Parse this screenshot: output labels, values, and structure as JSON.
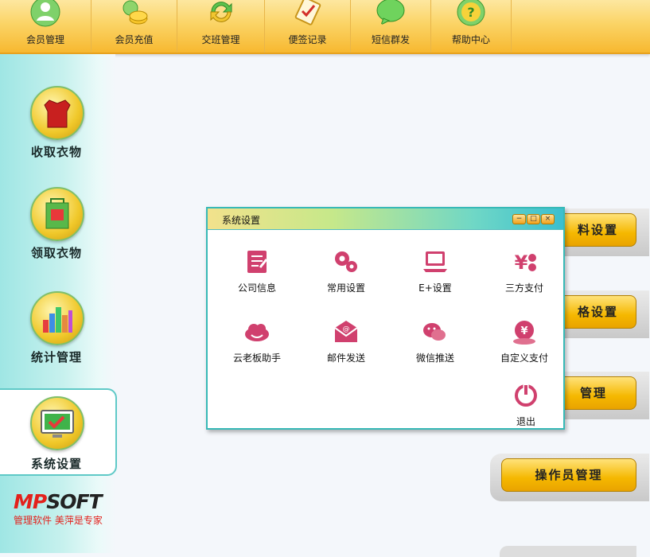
{
  "toolbar": {
    "items": [
      {
        "label": "会员管理",
        "icon": "member-icon"
      },
      {
        "label": "会员充值",
        "icon": "recharge-icon"
      },
      {
        "label": "交班管理",
        "icon": "shift-icon"
      },
      {
        "label": "便签记录",
        "icon": "notes-icon"
      },
      {
        "label": "短信群发",
        "icon": "sms-icon"
      },
      {
        "label": "帮助中心",
        "icon": "help-icon"
      }
    ]
  },
  "sidebar": {
    "items": [
      {
        "label": "收取衣物",
        "icon": "coat-icon"
      },
      {
        "label": "领取衣物",
        "icon": "bag-icon"
      },
      {
        "label": "统计管理",
        "icon": "stats-icon"
      },
      {
        "label": "系统设置",
        "icon": "monitor-icon"
      }
    ],
    "active_index": 3
  },
  "logo": {
    "brand_mp": "MP",
    "brand_soft": "SOFT",
    "slogan": "管理软件  美萍是专家"
  },
  "right_buttons": [
    {
      "label": "料设置"
    },
    {
      "label": "格设置"
    },
    {
      "label": "管理"
    },
    {
      "label": "操作员管理"
    }
  ],
  "dialog": {
    "title": "系统设置",
    "controls": {
      "minimize": "−",
      "maximize": "□",
      "close": "×"
    },
    "items": [
      {
        "label": "公司信息",
        "icon": "company-info-icon"
      },
      {
        "label": "常用设置",
        "icon": "gears-icon"
      },
      {
        "label": "E+设置",
        "icon": "laptop-icon"
      },
      {
        "label": "三方支付",
        "icon": "yen-icon"
      },
      {
        "label": "云老板助手",
        "icon": "cloud-icon"
      },
      {
        "label": "邮件发送",
        "icon": "mail-icon"
      },
      {
        "label": "微信推送",
        "icon": "wechat-icon"
      },
      {
        "label": "自定义支付",
        "icon": "custom-pay-icon"
      },
      {
        "label": "退出",
        "icon": "power-icon"
      }
    ]
  },
  "colors": {
    "accent": "#f5b800",
    "teal": "#37b9b7",
    "icon_pink": "#d0406e",
    "brand_red": "#e3211c"
  }
}
